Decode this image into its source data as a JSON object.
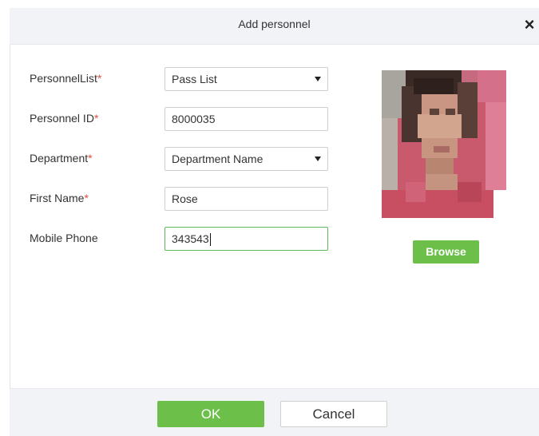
{
  "dialog": {
    "title": "Add personnel",
    "close_label": "×"
  },
  "form": {
    "personnel_list": {
      "label": "PersonnelList",
      "required": "*",
      "value": "Pass List"
    },
    "personnel_id": {
      "label": "Personnel ID",
      "required": "*",
      "value": "8000035"
    },
    "department": {
      "label": "Department",
      "required": "*",
      "value": "Department Name"
    },
    "first_name": {
      "label": "First Name",
      "required": "*",
      "value": "Rose"
    },
    "mobile_phone": {
      "label": "Mobile Phone",
      "value": "343543"
    }
  },
  "photo": {
    "browse_label": "Browse"
  },
  "footer": {
    "ok_label": "OK",
    "cancel_label": "Cancel"
  },
  "colors": {
    "accent_green": "#6cc04a",
    "required_red": "#e74c3c",
    "header_bg": "#f1f3f7"
  }
}
